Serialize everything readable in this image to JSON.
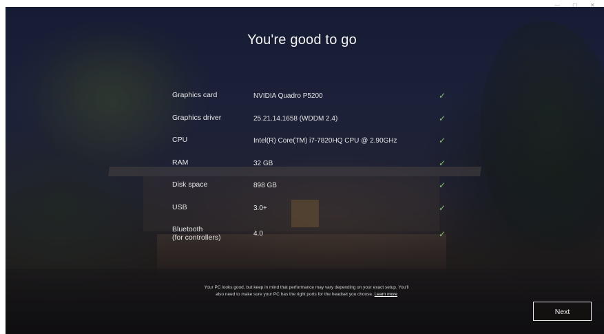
{
  "header": {
    "title": "You're good to go"
  },
  "window_controls": {
    "glyphs": "—  ▢  ✕"
  },
  "specs": [
    {
      "label": "Graphics card",
      "value": "NVIDIA Quadro P5200",
      "status_icon": "checkmark-icon"
    },
    {
      "label": "Graphics driver",
      "value": "25.21.14.1658 (WDDM 2.4)",
      "status_icon": "checkmark-icon"
    },
    {
      "label": "CPU",
      "value": "Intel(R) Core(TM) i7-7820HQ CPU @ 2.90GHz",
      "status_icon": "checkmark-icon"
    },
    {
      "label": "RAM",
      "value": "32 GB",
      "status_icon": "checkmark-icon"
    },
    {
      "label": "Disk space",
      "value": "898 GB",
      "status_icon": "checkmark-icon"
    },
    {
      "label": "USB",
      "value": "3.0+",
      "status_icon": "checkmark-icon"
    },
    {
      "label": "Bluetooth\n(for controllers)",
      "value": "4.0",
      "status_icon": "checkmark-icon"
    }
  ],
  "check_glyph": "✓",
  "colors": {
    "check": "#86c76e",
    "text": "#e6e6e6"
  },
  "footer": {
    "note_line1": "Your PC looks good, but keep in mind that performance may vary depending on your exact setup. You'll",
    "note_line2": "also need to make sure your PC has the right ports for the headset you choose.",
    "learn_more": "Learn more",
    "next_label": "Next"
  }
}
